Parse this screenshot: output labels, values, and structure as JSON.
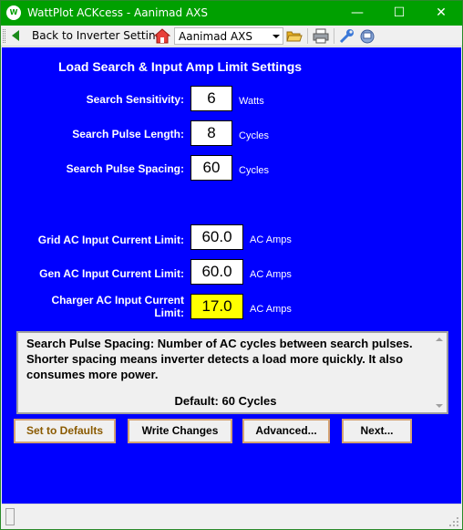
{
  "window": {
    "title": "WattPlot ACKcess - Aanimad AXS",
    "app_icon_text": "W"
  },
  "toolbar": {
    "back_label": "Back to Inverter Settings",
    "device_select_value": "Aanimad AXS",
    "icons": [
      "back-arrow-icon",
      "home-icon",
      "folder-open-icon",
      "print-icon",
      "wrench-icon",
      "network-icon"
    ]
  },
  "main": {
    "heading": "Load Search & Input Amp Limit Settings",
    "search": [
      {
        "label": "Search Sensitivity:",
        "value": "6",
        "unit": "Watts"
      },
      {
        "label": "Search Pulse Length:",
        "value": "8",
        "unit": "Cycles"
      },
      {
        "label": "Search Pulse Spacing:",
        "value": "60",
        "unit": "Cycles"
      }
    ],
    "limits": [
      {
        "label": "Grid AC Input Current Limit:",
        "value": "60.0",
        "unit": "AC Amps"
      },
      {
        "label": "Gen AC Input Current Limit:",
        "value": "60.0",
        "unit": "AC Amps"
      },
      {
        "label_line1": "Charger AC Input Current",
        "label_line2": "Limit:",
        "value": "17.0",
        "unit": "AC Amps"
      }
    ],
    "info": {
      "text": "Search Pulse Spacing:    Number of AC cycles between search pulses.  Shorter spacing means inverter detects a load more quickly.  It also consumes more power.",
      "default": "Default:  60 Cycles"
    },
    "buttons": {
      "defaults": "Set to Defaults",
      "write": "Write Changes",
      "advanced": "Advanced...",
      "next": "Next..."
    }
  },
  "colors": {
    "title_bar": "#00a000",
    "panel_bg": "#0000ff",
    "highlight_field": "#ffff00"
  }
}
